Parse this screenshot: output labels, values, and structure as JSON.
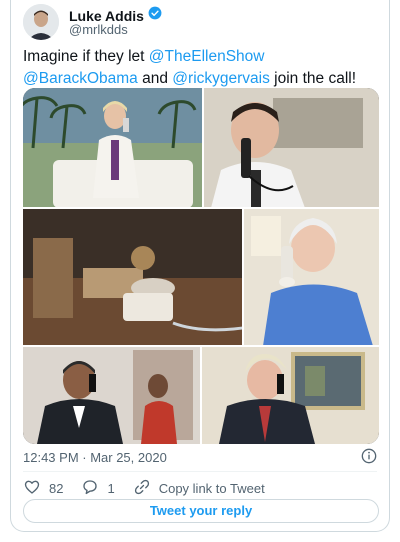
{
  "author": {
    "name": "Luke Addis",
    "handle": "@mrlkdds"
  },
  "tweet": {
    "text_before": "Imagine if they let ",
    "mention1": "@TheEllenShow",
    "mention2": "@BarackObama",
    "text_and": " and ",
    "mention3": "@rickygervais",
    "text_after": " join the call!"
  },
  "meta": {
    "timestamp": "12:43 PM · Mar 25, 2020"
  },
  "actions": {
    "likes": "82",
    "replies": "1",
    "copy_link": "Copy link to Tweet"
  },
  "reply_button": "Tweet your reply",
  "colors": {
    "accent": "#1d9bf0",
    "muted": "#536471"
  }
}
